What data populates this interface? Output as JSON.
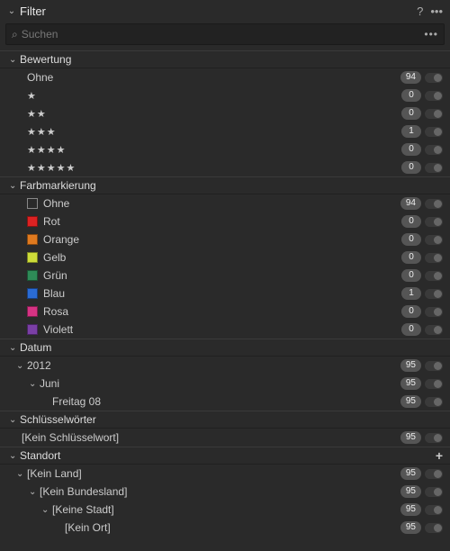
{
  "titlebar": {
    "title": "Filter",
    "help": "?",
    "more": "•••"
  },
  "search": {
    "placeholder": "Suchen",
    "more": "•••"
  },
  "sections": {
    "rating": {
      "title": "Bewertung",
      "rows": [
        {
          "label": "Ohne",
          "count": 94,
          "stars": 0
        },
        {
          "label": "",
          "count": 0,
          "stars": 1
        },
        {
          "label": "",
          "count": 0,
          "stars": 2
        },
        {
          "label": "",
          "count": 1,
          "stars": 3
        },
        {
          "label": "",
          "count": 0,
          "stars": 4
        },
        {
          "label": "",
          "count": 0,
          "stars": 5
        }
      ]
    },
    "color": {
      "title": "Farbmarkierung",
      "rows": [
        {
          "label": "Ohne",
          "count": 94,
          "color": "none"
        },
        {
          "label": "Rot",
          "count": 0,
          "color": "#d22"
        },
        {
          "label": "Orange",
          "count": 0,
          "color": "#e07a1f"
        },
        {
          "label": "Gelb",
          "count": 0,
          "color": "#cddc39"
        },
        {
          "label": "Grün",
          "count": 0,
          "color": "#2e8b57"
        },
        {
          "label": "Blau",
          "count": 1,
          "color": "#2a6bd4"
        },
        {
          "label": "Rosa",
          "count": 0,
          "color": "#d63384"
        },
        {
          "label": "Violett",
          "count": 0,
          "color": "#7a3fa5"
        }
      ]
    },
    "date": {
      "title": "Datum",
      "tree": [
        {
          "label": "2012",
          "count": 95,
          "depth": 0,
          "chev": true
        },
        {
          "label": "Juni",
          "count": 95,
          "depth": 1,
          "chev": true
        },
        {
          "label": "Freitag 08",
          "count": 95,
          "depth": 2,
          "chev": false
        }
      ]
    },
    "keywords": {
      "title": "Schlüsselwörter",
      "rows": [
        {
          "label": "[Kein Schlüsselwort]",
          "count": 95
        }
      ]
    },
    "location": {
      "title": "Standort",
      "tail": "+",
      "tree": [
        {
          "label": "[Kein Land]",
          "count": 95,
          "depth": 0
        },
        {
          "label": "[Kein Bundesland]",
          "count": 95,
          "depth": 1
        },
        {
          "label": "[Keine Stadt]",
          "count": 95,
          "depth": 2
        },
        {
          "label": "[Kein Ort]",
          "count": 95,
          "depth": 3
        }
      ]
    }
  }
}
